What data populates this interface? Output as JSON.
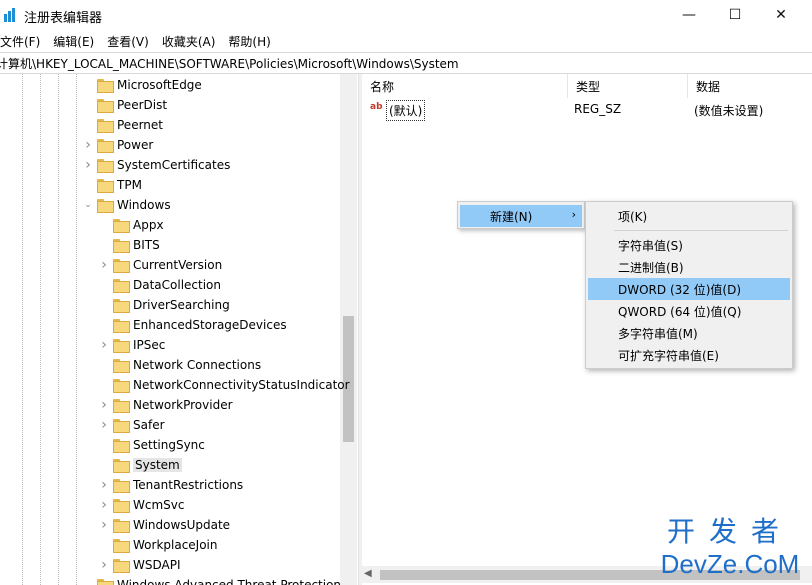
{
  "window": {
    "title": "注册表编辑器",
    "min_label": "—",
    "max_label": "☐",
    "close_label": "✕"
  },
  "menu": [
    "文件(F)",
    "编辑(E)",
    "查看(V)",
    "收藏夹(A)",
    "帮助(H)"
  ],
  "address": "计算机\\HKEY_LOCAL_MACHINE\\SOFTWARE\\Policies\\Microsoft\\Windows\\System",
  "tree": [
    {
      "label": "MicrosoftEdge",
      "level": 1,
      "chevron": "",
      "selected": false
    },
    {
      "label": "PeerDist",
      "level": 1,
      "chevron": "",
      "selected": false
    },
    {
      "label": "Peernet",
      "level": 1,
      "chevron": "",
      "selected": false
    },
    {
      "label": "Power",
      "level": 1,
      "chevron": "right",
      "selected": false
    },
    {
      "label": "SystemCertificates",
      "level": 1,
      "chevron": "right",
      "selected": false
    },
    {
      "label": "TPM",
      "level": 1,
      "chevron": "",
      "selected": false
    },
    {
      "label": "Windows",
      "level": 1,
      "chevron": "down",
      "selected": false
    },
    {
      "label": "Appx",
      "level": 2,
      "chevron": "",
      "selected": false
    },
    {
      "label": "BITS",
      "level": 2,
      "chevron": "",
      "selected": false
    },
    {
      "label": "CurrentVersion",
      "level": 2,
      "chevron": "right",
      "selected": false
    },
    {
      "label": "DataCollection",
      "level": 2,
      "chevron": "",
      "selected": false
    },
    {
      "label": "DriverSearching",
      "level": 2,
      "chevron": "",
      "selected": false
    },
    {
      "label": "EnhancedStorageDevices",
      "level": 2,
      "chevron": "",
      "selected": false
    },
    {
      "label": "IPSec",
      "level": 2,
      "chevron": "right",
      "selected": false
    },
    {
      "label": "Network Connections",
      "level": 2,
      "chevron": "",
      "selected": false
    },
    {
      "label": "NetworkConnectivityStatusIndicator",
      "level": 2,
      "chevron": "",
      "selected": false
    },
    {
      "label": "NetworkProvider",
      "level": 2,
      "chevron": "right",
      "selected": false
    },
    {
      "label": "Safer",
      "level": 2,
      "chevron": "right",
      "selected": false
    },
    {
      "label": "SettingSync",
      "level": 2,
      "chevron": "",
      "selected": false
    },
    {
      "label": "System",
      "level": 2,
      "chevron": "",
      "selected": true
    },
    {
      "label": "TenantRestrictions",
      "level": 2,
      "chevron": "right",
      "selected": false
    },
    {
      "label": "WcmSvc",
      "level": 2,
      "chevron": "right",
      "selected": false
    },
    {
      "label": "WindowsUpdate",
      "level": 2,
      "chevron": "right",
      "selected": false
    },
    {
      "label": "WorkplaceJoin",
      "level": 2,
      "chevron": "",
      "selected": false
    },
    {
      "label": "WSDAPI",
      "level": 2,
      "chevron": "right",
      "selected": false
    },
    {
      "label": "Windows Advanced Threat Protection",
      "level": 1,
      "chevron": "",
      "selected": false
    }
  ],
  "list": {
    "columns": {
      "name": "名称",
      "type": "类型",
      "data": "数据"
    },
    "rows": [
      {
        "icon": "string-value-icon",
        "icon_text": "ab",
        "name": "(默认)",
        "type": "REG_SZ",
        "data": "(数值未设置)"
      }
    ]
  },
  "context_menu": {
    "new_label": "新建(N)",
    "submenu": [
      {
        "label": "项(K)",
        "highlighted": false
      },
      {
        "separator": true
      },
      {
        "label": "字符串值(S)",
        "highlighted": false
      },
      {
        "label": "二进制值(B)",
        "highlighted": false
      },
      {
        "label": "DWORD (32 位)值(D)",
        "highlighted": true
      },
      {
        "label": "QWORD (64 位)值(Q)",
        "highlighted": false
      },
      {
        "label": "多字符串值(M)",
        "highlighted": false
      },
      {
        "label": "可扩充字符串值(E)",
        "highlighted": false
      }
    ]
  },
  "watermark": {
    "line1": "开发者",
    "line2": "DevZe.CoM"
  },
  "colors": {
    "highlight": "#91c9f7",
    "folder": "#f7d87c",
    "watermark": "#1f6fc9"
  }
}
